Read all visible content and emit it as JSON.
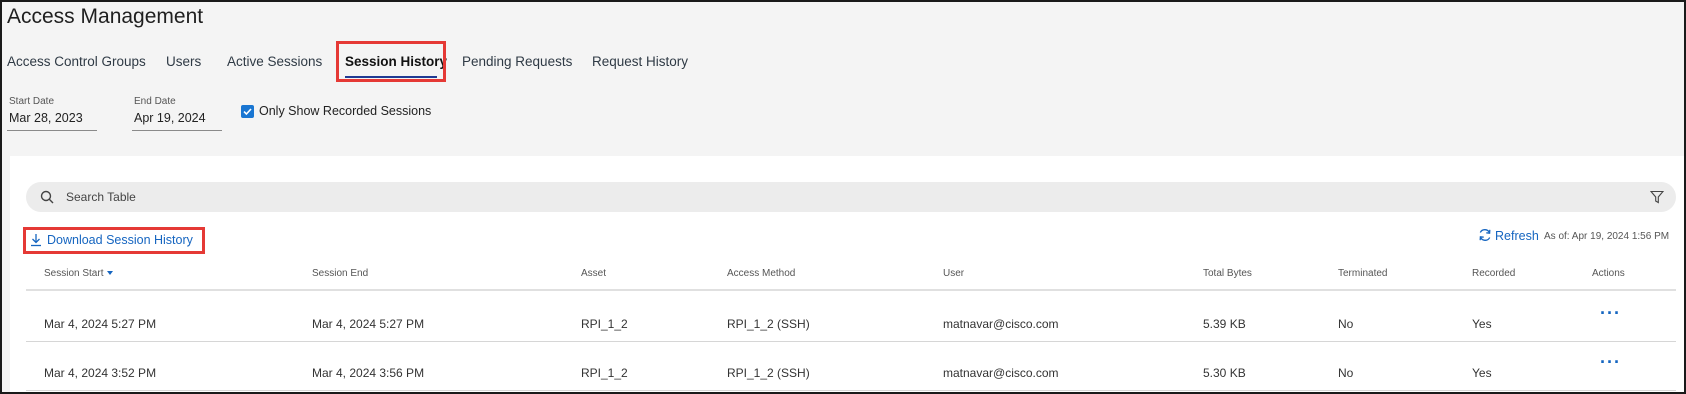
{
  "page": {
    "title": "Access Management"
  },
  "tabs": [
    {
      "label": "Access Control Groups",
      "active": false
    },
    {
      "label": "Users",
      "active": false
    },
    {
      "label": "Active Sessions",
      "active": false
    },
    {
      "label": "Session History",
      "active": true
    },
    {
      "label": "Pending Requests",
      "active": false
    },
    {
      "label": "Request History",
      "active": false
    }
  ],
  "filters": {
    "start_date": {
      "label": "Start Date",
      "value": "Mar 28, 2023"
    },
    "end_date": {
      "label": "End Date",
      "value": "Apr 19, 2024"
    },
    "only_recorded": {
      "label": "Only Show Recorded Sessions",
      "checked": true
    }
  },
  "search": {
    "placeholder": "Search Table"
  },
  "toolbar": {
    "download_label": "Download Session History",
    "refresh_label": "Refresh",
    "as_of": "As of: Apr 19, 2024 1:56 PM"
  },
  "table": {
    "columns": [
      "Session Start",
      "Session End",
      "Asset",
      "Access Method",
      "User",
      "Total Bytes",
      "Terminated",
      "Recorded",
      "Actions"
    ],
    "sort_column": "Session Start",
    "rows": [
      {
        "session_start": "Mar 4, 2024 5:27 PM",
        "session_end": "Mar 4, 2024 5:27 PM",
        "asset": "RPI_1_2",
        "access_method": "RPI_1_2 (SSH)",
        "user": "matnavar@cisco.com",
        "total_bytes": "5.39 KB",
        "terminated": "No",
        "recorded": "Yes",
        "actions": "···"
      },
      {
        "session_start": "Mar 4, 2024 3:52 PM",
        "session_end": "Mar 4, 2024 3:56 PM",
        "asset": "RPI_1_2",
        "access_method": "RPI_1_2 (SSH)",
        "user": "matnavar@cisco.com",
        "total_bytes": "5.30 KB",
        "terminated": "No",
        "recorded": "Yes",
        "actions": "···"
      }
    ]
  },
  "colors": {
    "accent": "#1565c0",
    "highlight": "#e53935",
    "checkbox": "#1976d2",
    "tab_underline": "#1f3a93"
  }
}
